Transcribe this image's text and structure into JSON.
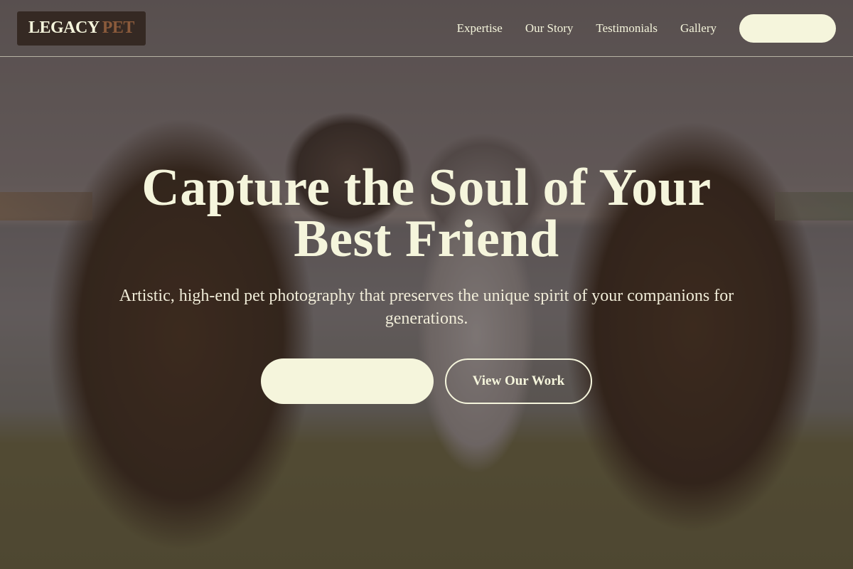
{
  "brand": {
    "name_primary": "LEGACY",
    "name_accent": "PET",
    "accent_color": "#8a5a3b",
    "cream_color": "#f5f5dc"
  },
  "nav": {
    "links": [
      "Expertise",
      "Our Story",
      "Testimonials",
      "Gallery"
    ],
    "cta_label": ""
  },
  "hero": {
    "headline": "Capture the Soul of Your Best Friend",
    "subheadline": "Artistic, high-end pet photography that preserves the unique spirit of your companions for generations.",
    "primary_cta_label": "",
    "secondary_cta_label": "View Our Work"
  }
}
